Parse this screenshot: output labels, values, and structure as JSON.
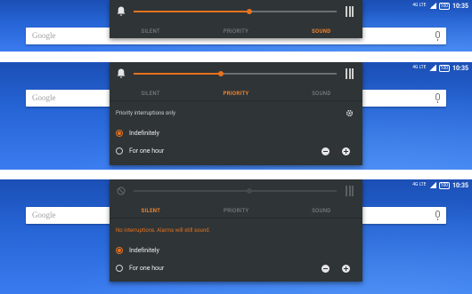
{
  "status": {
    "lte": "4G LTE",
    "battery": "100",
    "time": "10:35"
  },
  "search": {
    "logo": "Google"
  },
  "tabs": {
    "silent": "SILENT",
    "priority": "PRIORITY",
    "sound": "SOUND"
  },
  "panels": [
    {
      "active": "sound",
      "volume_level": 0.57
    },
    {
      "active": "priority",
      "volume_level": 0.43,
      "caption": "Priority interruptions only",
      "opt1": "Indefinitely",
      "opt2": "For one hour"
    },
    {
      "active": "silent",
      "volume_level": 0.57,
      "caption": "No interruptions. Alarms will still sound.",
      "opt1": "Indefinitely",
      "opt2": "For one hour"
    }
  ],
  "colors": {
    "accent": "#e8721c",
    "panel": "#2f3437",
    "wallpaper": "#2563d3"
  }
}
